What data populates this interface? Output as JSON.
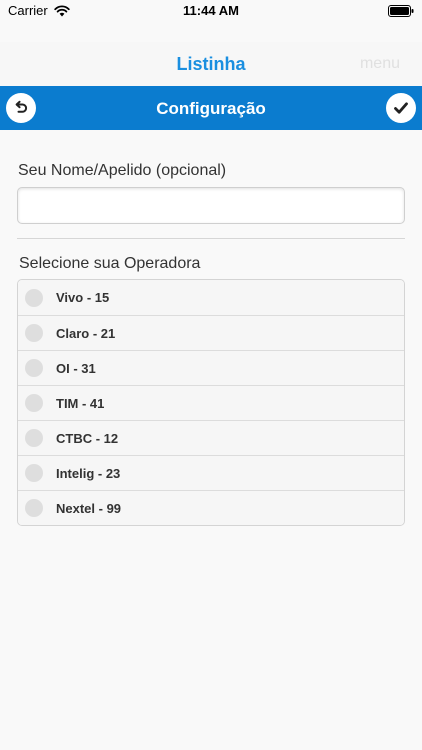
{
  "status_bar": {
    "carrier": "Carrier",
    "time": "11:44 AM"
  },
  "top_nav": {
    "title": "Listinha",
    "menu": "menu"
  },
  "header": {
    "title": "Configuração"
  },
  "form": {
    "name_label": "Seu Nome/Apelido (opcional)",
    "name_value": "",
    "operator_label": "Selecione sua Operadora"
  },
  "operators": [
    "Vivo - 15",
    "Claro - 21",
    "OI - 31",
    "TIM - 41",
    "CTBC - 12",
    "Intelig - 23",
    "Nextel - 99"
  ],
  "colors": {
    "header_bg": "#0b7ccf",
    "title_blue": "#1a8fe0"
  }
}
